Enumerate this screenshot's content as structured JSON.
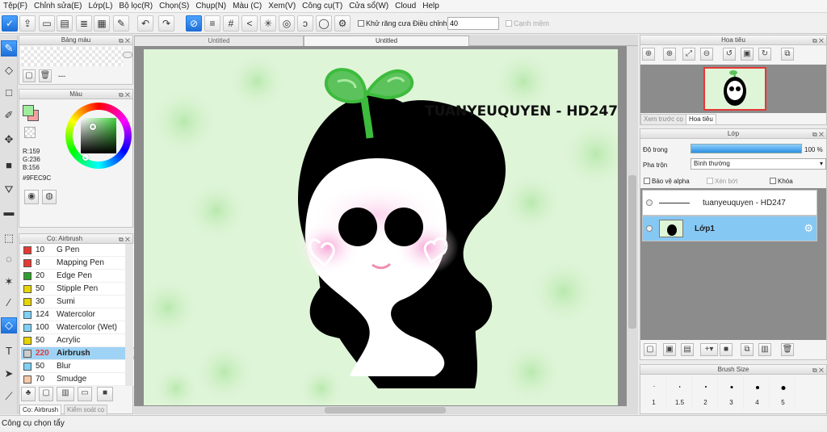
{
  "menu": [
    "Tệp(F)",
    "Chỉnh sửa(E)",
    "Lớp(L)",
    "Bộ lọc(R)",
    "Chọn(S)",
    "Chụp(N)",
    "Màu (C)",
    "Xem(V)",
    "Công cụ(T)",
    "Cửa sổ(W)",
    "Cloud",
    "Help"
  ],
  "toolbar": {
    "antialias_label": "Khử răng cưa",
    "adjust_label": "Điều chỉnh",
    "adjust_value": "40",
    "edge_label": "Cạnh mềm"
  },
  "palette_panel": {
    "title": "Bảng màu",
    "dash": "---"
  },
  "color_panel": {
    "title": "Màu",
    "r": "R:159",
    "g": "G:236",
    "b": "B:156",
    "hex": "#9FEC9C",
    "primary": "#9fec9c",
    "secondary": "#f4a0a0"
  },
  "brush_panel": {
    "title": "Cọ: Airbrush",
    "items": [
      {
        "size": "10",
        "name": "G Pen",
        "color": "#e53935"
      },
      {
        "size": "8",
        "name": "Mapping Pen",
        "color": "#e53935"
      },
      {
        "size": "20",
        "name": "Edge Pen",
        "color": "#2e9e2e"
      },
      {
        "size": "50",
        "name": "Stipple Pen",
        "color": "#e8d400"
      },
      {
        "size": "30",
        "name": "Sumi",
        "color": "#e8d400"
      },
      {
        "size": "124",
        "name": "Watercolor",
        "color": "#7fd0f5"
      },
      {
        "size": "100",
        "name": "Watercolor (Wet)",
        "color": "#7fd0f5"
      },
      {
        "size": "50",
        "name": "Acrylic",
        "color": "#e8d400"
      },
      {
        "size": "220",
        "name": "Airbrush",
        "color": "#cccccc"
      },
      {
        "size": "50",
        "name": "Blur",
        "color": "#7fd0f5"
      },
      {
        "size": "70",
        "name": "Smudge",
        "color": "#f6c9a8"
      }
    ],
    "tab_active": "Cọ: Airbrush",
    "tab_other": "Kiểm soát cọ"
  },
  "document": {
    "tab1": "Untitled",
    "tab2": "Untitled",
    "watermark": "TUANYEUQUYEN - HD247"
  },
  "navigator": {
    "title": "Hoa tiêu",
    "tab_preview": "Xem trước cọ",
    "tab_nav": "Hoa tiêu"
  },
  "layer_panel": {
    "title": "Lớp",
    "opacity_label": "Độ trong",
    "opacity_value": "100 %",
    "opacity": 1.0,
    "blend_label": "Pha trộn",
    "blend_value": "Bình thường",
    "protect_alpha": "Bảo vệ alpha",
    "clip": "Xén bớt",
    "lock": "Khóa",
    "layers": [
      {
        "name": "tuanyeuquyen - HD247"
      },
      {
        "name": "Lớp1"
      }
    ]
  },
  "brush_size": {
    "title": "Brush Size",
    "sizes": [
      "1",
      "1.5",
      "2",
      "3",
      "4",
      "5"
    ]
  },
  "status": "Công cụ chọn tẩy"
}
